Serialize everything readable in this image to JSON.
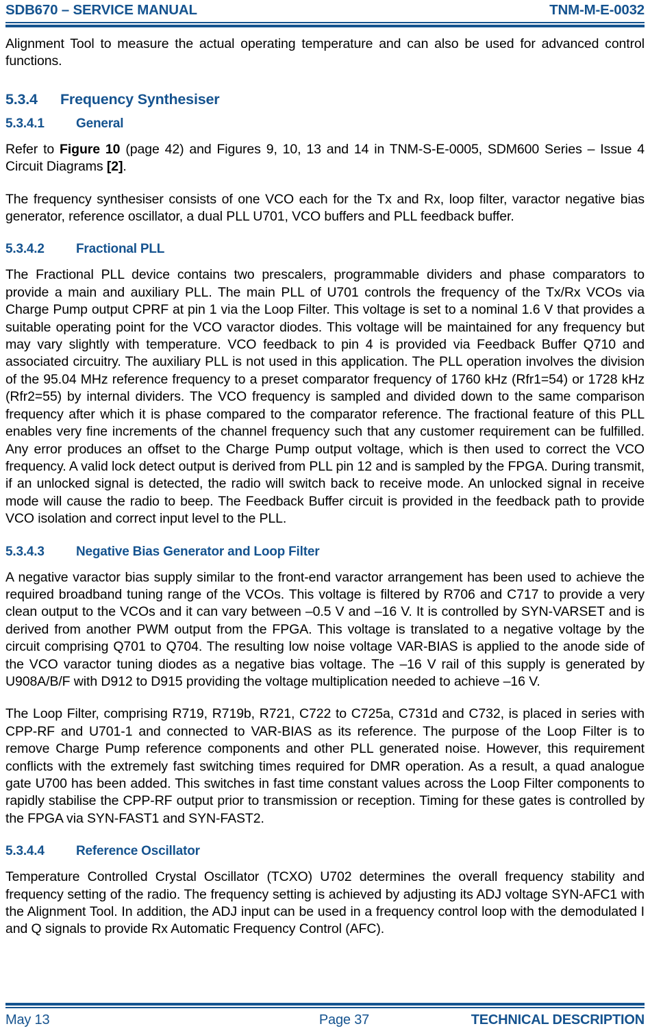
{
  "header": {
    "left": "SDB670 – SERVICE MANUAL",
    "right": "TNM-M-E-0032"
  },
  "content": {
    "intro_paragraph": "Alignment Tool to measure the actual operating temperature and can also be used for advanced control functions.",
    "section_534": {
      "number": "5.3.4",
      "title": "Frequency Synthesiser"
    },
    "section_5341": {
      "number": "5.3.4.1",
      "title": "General",
      "para_1_pre": "Refer to ",
      "para_1_bold_1": "Figure 10",
      "para_1_mid": " (page 42) and Figures 9, 10, 13 and 14 in TNM-S-E-0005, SDM600 Series – Issue 4 Circuit Diagrams ",
      "para_1_bold_2": "[2]",
      "para_1_post": ".",
      "para_2": "The frequency synthesiser consists of one VCO each for the Tx and Rx, loop filter, varactor negative bias generator, reference oscillator, a dual PLL U701, VCO buffers and PLL feedback buffer."
    },
    "section_5342": {
      "number": "5.3.4.2",
      "title": "Fractional PLL",
      "para_1": "The Fractional PLL device contains two prescalers, programmable dividers and phase comparators to provide a main and auxiliary PLL.  The main PLL of U701 controls the frequency of the Tx/Rx VCOs via Charge Pump output CPRF at pin 1 via the Loop Filter.  This voltage is set to a nominal 1.6 V that provides a suitable operating point for the VCO varactor diodes.  This voltage will be maintained for any frequency but may vary slightly with temperature.  VCO feedback to pin 4 is provided via Feedback Buffer Q710 and associated circuitry.  The auxiliary PLL is not used in this application.  The PLL operation involves the division of the 95.04 MHz reference frequency to a preset comparator frequency of 1760 kHz (Rfr1=54) or 1728 kHz (Rfr2=55) by internal dividers.  The VCO frequency is sampled and divided down to the same comparison frequency after which it is phase compared to the comparator reference.  The fractional feature of this PLL enables very fine increments of the channel frequency such that any customer requirement can be fulfilled.  Any error produces an offset to the Charge Pump output voltage, which is then used to correct the VCO frequency.  A valid lock detect output is derived from PLL pin 12 and is sampled by the FPGA.  During transmit, if an unlocked signal is detected, the radio will switch back to receive mode.  An unlocked signal in receive mode will cause the radio to beep.  The Feedback Buffer circuit is provided in the feedback path to provide VCO isolation and correct input level to the PLL."
    },
    "section_5343": {
      "number": "5.3.4.3",
      "title": "Negative Bias Generator and Loop Filter",
      "para_1": "A negative varactor bias supply similar to the front-end varactor arrangement has been used to achieve the required broadband tuning range of the VCOs.  This voltage is filtered by R706 and C717 to provide a very clean output to the VCOs and it can vary between –0.5 V and –16 V.  It is controlled by SYN-VARSET and is derived from another PWM output from the FPGA.  This voltage is translated to a negative voltage by the circuit comprising Q701 to Q704.  The resulting low noise voltage VAR-BIAS is applied to the anode side of the VCO varactor tuning diodes as a negative bias voltage.  The –16 V rail of this supply is generated by U908A/B/F with D912 to D915 providing the voltage multiplication needed to achieve –16 V.",
      "para_2": "The Loop Filter, comprising R719, R719b, R721, C722 to C725a, C731d and C732, is placed in series with CPP-RF and U701-1 and connected to VAR-BIAS as its reference.  The purpose of the Loop Filter is to remove Charge Pump reference components and other PLL generated noise.  However, this requirement conflicts with the extremely fast switching times required for DMR operation.  As a result, a quad analogue gate U700 has been added.  This switches in fast time constant values across the Loop Filter components to rapidly stabilise the CPP-RF output prior to transmission or reception.  Timing for these gates is controlled by the FPGA via SYN-FAST1 and SYN-FAST2."
    },
    "section_5344": {
      "number": "5.3.4.4",
      "title": "Reference Oscillator",
      "para_1": "Temperature Controlled Crystal Oscillator (TCXO) U702 determines the overall frequency stability and frequency setting of the radio.  The frequency setting is achieved by adjusting its ADJ voltage SYN-AFC1 with the Alignment Tool.  In addition, the ADJ input can be used in a frequency control loop with the demodulated I and Q signals to provide Rx Automatic Frequency Control (AFC)."
    }
  },
  "footer": {
    "left": "May 13",
    "center": "Page 37",
    "right": "TECHNICAL DESCRIPTION"
  },
  "colors": {
    "accent_blue": "#15538f",
    "body_text": "#000000"
  }
}
